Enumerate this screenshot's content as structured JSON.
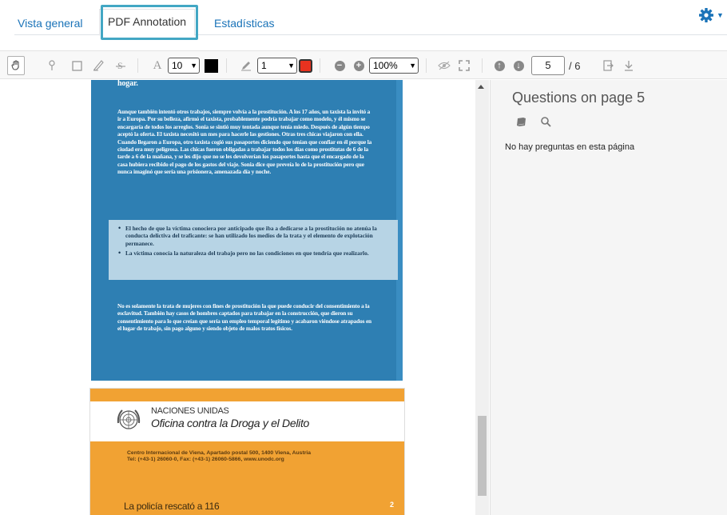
{
  "tabs": [
    {
      "label": "Vista general"
    },
    {
      "label": "PDF Annotation"
    },
    {
      "label": "Estadísticas"
    }
  ],
  "toolbar": {
    "font_size": "10",
    "stroke_width": "1",
    "zoom": "100%",
    "page_current": "5",
    "page_total": "/ 6",
    "text_tool_glyph": "A",
    "colors": {
      "text_color": "#000000",
      "stroke_color": "#e8321f",
      "accent": "#43a7c4",
      "link": "#1a73b8"
    }
  },
  "document": {
    "heading_fragment": "hogar.",
    "paragraph_1": "Aunque también intentó otros trabajos, siempre volvía a la prostitución. A los 17 años, un taxista la invitó a ir a Europa. Por su belleza, afirmó el taxista, probablemente podría trabajar como modelo, y él mismo se encargaría de todos los arreglos. Sonia se sintió muy tentada aunque tenía miedo. Después de algún tiempo aceptó la oferta. El taxista necesitó un mes para hacerle las gestiones. Otras tres chicas viajaron con ella. Cuando llegaron a Europa, otro taxista cogió sus pasaportes diciendo que tenían que confiar en él porque la ciudad era muy peligrosa. Las chicas fueron obligadas a trabajar todos los días como prostitutas de 6 de la tarde a 6 de la mañana, y se les dijo que no se les devolverían los pasaportes hasta que el encargado de la casa hubiera recibido el pago de los gastos del viaje. Sonia dice que preveía lo de la prostitución pero que nunca imaginó que sería una prisionera, amenazada día y noche.",
    "bullets": [
      "El hecho de que la víctima conociera por anticipado que iba a dedicarse a la prostitución no atenúa la conducta delictiva del traficante: se han utilizado los medios de la trata y el elemento de explotación permanece.",
      "La víctima conocía la naturaleza del trabajo pero no las condiciones en que tendría que realizarlo."
    ],
    "paragraph_2": "No es solamente la trata de mujeres con fines de prostitución la que puede conducir del consentimiento a la esclavitud. También hay casos de hombres captados para trabajar en la construcción, que dieron su consentimiento para lo que creían que sería un empleo temporal legítimo y acabaron viéndose atrapados en el lugar de trabajo, sin pago alguno y siendo objeto de malos tratos físicos.",
    "org_name": "NACIONES UNIDAS",
    "org_office": "Oficina contra la Droga y el Delito",
    "address_line_1": "Centro Internacional de Viena, Apartado postal 500, 1400 Viena, Austria",
    "address_line_2": "Tel: (+43-1) 26060-0, Fax: (+43-1) 26060-5866, www.unodc.org",
    "footer_title": "La policía rescató a 116",
    "footer_page": "2"
  },
  "questions_panel": {
    "title": "Questions on page 5",
    "empty_message": "No hay preguntas en esta página"
  }
}
